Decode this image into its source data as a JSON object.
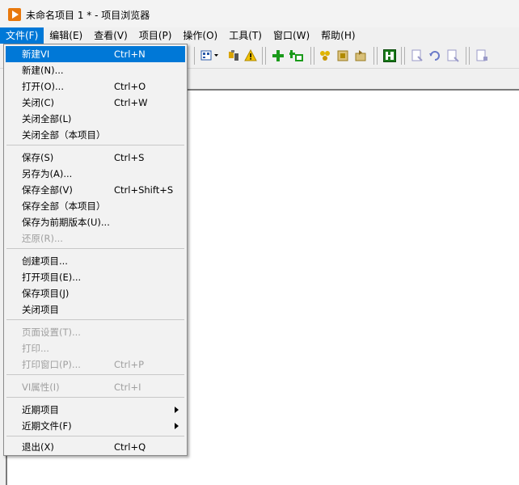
{
  "window": {
    "title": "未命名项目 1 * - 项目浏览器"
  },
  "menubar": {
    "items": [
      "文件(F)",
      "编辑(E)",
      "查看(V)",
      "项目(P)",
      "操作(O)",
      "工具(T)",
      "窗口(W)",
      "帮助(H)"
    ]
  },
  "toolbar": {
    "icons": [
      "new-vi-icon",
      "open-icon",
      "toolbar-partial-icon",
      "view-dropdown-icon",
      "filter-icon",
      "warning-icon",
      "add-item-icon",
      "add-folder-icon",
      "build-icon",
      "deploy-icon",
      "sync-icon",
      "properties-icon",
      "open-item-icon",
      "undo-icon",
      "find-icon",
      "find-next-icon"
    ]
  },
  "colors": {
    "highlight": "#0078d7",
    "accent_icon": "#e8780c"
  },
  "file_menu": {
    "items": [
      {
        "label": "新建VI",
        "shortcut": "Ctrl+N"
      },
      {
        "label": "新建(N)...",
        "shortcut": ""
      },
      {
        "label": "打开(O)...",
        "shortcut": "Ctrl+O"
      },
      {
        "label": "关闭(C)",
        "shortcut": "Ctrl+W"
      },
      {
        "label": "关闭全部(L)",
        "shortcut": ""
      },
      {
        "label": "关闭全部（本项目）",
        "shortcut": ""
      },
      {
        "label": "保存(S)",
        "shortcut": "Ctrl+S"
      },
      {
        "label": "另存为(A)...",
        "shortcut": ""
      },
      {
        "label": "保存全部(V)",
        "shortcut": "Ctrl+Shift+S"
      },
      {
        "label": "保存全部（本项目）",
        "shortcut": ""
      },
      {
        "label": "保存为前期版本(U)...",
        "shortcut": ""
      },
      {
        "label": "还原(R)...",
        "shortcut": ""
      },
      {
        "label": "创建项目...",
        "shortcut": ""
      },
      {
        "label": "打开项目(E)...",
        "shortcut": ""
      },
      {
        "label": "保存项目(J)",
        "shortcut": ""
      },
      {
        "label": "关闭项目",
        "shortcut": ""
      },
      {
        "label": "页面设置(T)...",
        "shortcut": ""
      },
      {
        "label": "打印...",
        "shortcut": ""
      },
      {
        "label": "打印窗口(P)...",
        "shortcut": "Ctrl+P"
      },
      {
        "label": "VI属性(I)",
        "shortcut": "Ctrl+I"
      },
      {
        "label": "近期项目",
        "shortcut": ""
      },
      {
        "label": "近期文件(F)",
        "shortcut": ""
      },
      {
        "label": "退出(X)",
        "shortcut": "Ctrl+Q"
      }
    ]
  }
}
